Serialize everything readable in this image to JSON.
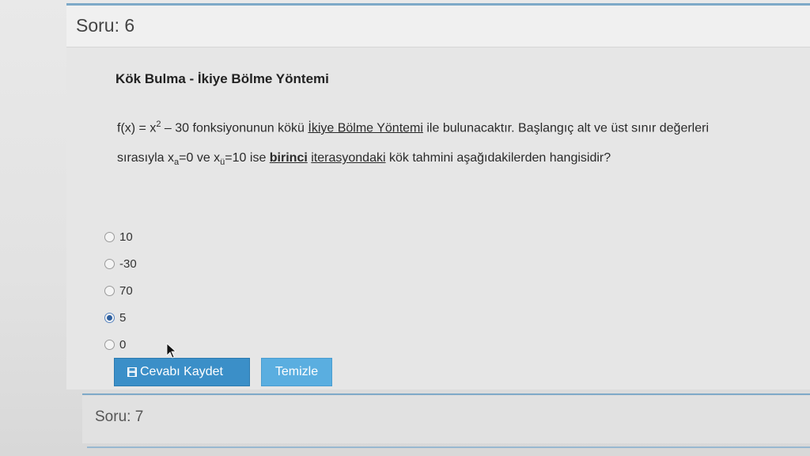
{
  "question": {
    "header": "Soru: 6",
    "heading": "Kök Bulma - İkiye Bölme Yöntemi",
    "text": {
      "fx": "f(x) = x",
      "exp": "2",
      "minus30": " – 30 ",
      "part1": "fonksiyonunun kökü ",
      "method": "İkiye Bölme Yöntemi",
      "part2": " ile bulunacaktır. Başlangıç alt ve üst sınır değerleri sırasıyla x",
      "sub_a": "a",
      "part3": "=0 ve x",
      "sub_u": "ü",
      "part4": "=10 ise ",
      "first": "birinci",
      "space": " ",
      "iteration": "iterasyondaki",
      "part5": " kök tahmini aşağıdakilerden hangisidir?"
    },
    "options": [
      {
        "label": "10",
        "checked": false
      },
      {
        "label": "-30",
        "checked": false
      },
      {
        "label": "70",
        "checked": false
      },
      {
        "label": "5",
        "checked": true
      },
      {
        "label": "0",
        "checked": false
      }
    ],
    "buttons": {
      "save_label": "Cevabı Kaydet",
      "save_icon": "save-icon",
      "clear_label": "Temizle"
    }
  },
  "next_question": {
    "header": "Soru: 7"
  },
  "colors": {
    "accent": "#3b8fc8",
    "rule": "#7ea9c8"
  }
}
